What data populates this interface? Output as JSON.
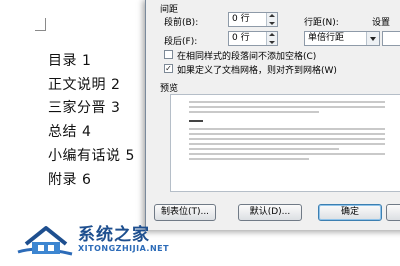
{
  "document": {
    "toc": [
      "目录 1",
      "正文说明 2",
      "三家分晋 3",
      "总结 4",
      "小编有话说 5",
      "附录 6"
    ]
  },
  "dialog": {
    "section_spacing": "间距",
    "before_label": "段前(B):",
    "before_value": "0 行",
    "after_label": "段后(F):",
    "after_value": "0 行",
    "line_spacing_label": "行距(N):",
    "line_spacing_value": "单倍行距",
    "setting_label": "设置",
    "checkbox_no_space": "在相同样式的段落间不添加空格(C)",
    "checkbox_no_space_checked": false,
    "checkbox_grid": "如果定义了文档网格，则对齐到网格(W)",
    "checkbox_grid_checked": true,
    "preview_label": "预览",
    "buttons": {
      "tabs": "制表位(T)...",
      "default": "默认(D)...",
      "ok": "确定"
    }
  },
  "watermark": {
    "title": "系统之家",
    "url": "XITONGZHIJIA.NET"
  },
  "colors": {
    "dialog_bg": "#f0f0f0",
    "watermark_blue": "#1e4f8f"
  }
}
